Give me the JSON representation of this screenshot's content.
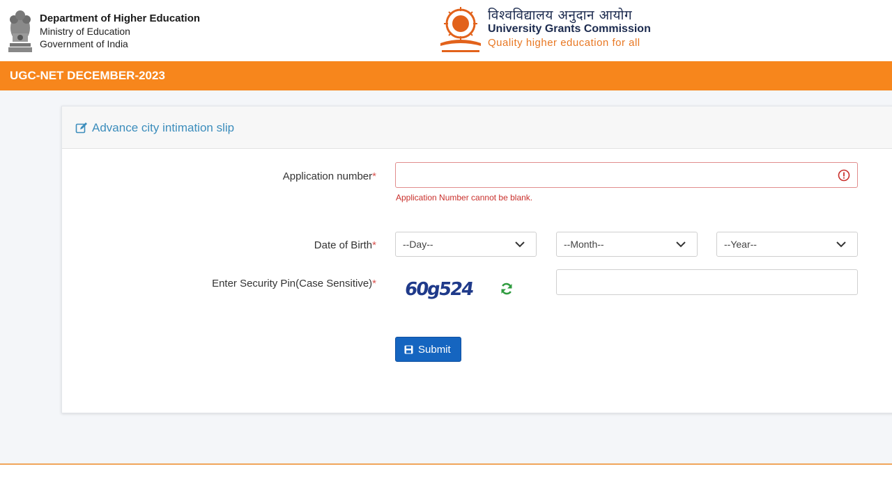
{
  "header": {
    "dept_title": "Department of Higher Education",
    "ministry": "Ministry of Education",
    "government": "Government of India",
    "ugc_hindi": "विश्वविद्यालय अनुदान आयोग",
    "ugc_name": "University Grants Commission",
    "ugc_tagline": "Quality higher education for all"
  },
  "banner": {
    "title": "UGC-NET DECEMBER-2023"
  },
  "form": {
    "title": "Advance city intimation slip",
    "application_label": "Application number",
    "required_mark": "*",
    "application_value": "",
    "application_error": "Application Number cannot be blank.",
    "dob_label": "Date of Birth",
    "day_selected": "--Day--",
    "month_selected": "--Month--",
    "year_selected": "--Year--",
    "pin_label": "Enter Security Pin(Case Sensitive)",
    "captcha_text": "60g524",
    "pin_value": "",
    "submit_label": "Submit"
  },
  "icons": {
    "header_icon": "edit-icon",
    "error_icon": "alert-circle-icon",
    "refresh_icon": "refresh-icon",
    "submit_icon": "save-icon",
    "dropdown_icon": "chevron-down-icon"
  },
  "colors": {
    "banner": "#f7861c",
    "accent_blue": "#3c8dbc",
    "button": "#1565c0",
    "error": "#c9302c",
    "tagline": "#e87722"
  }
}
